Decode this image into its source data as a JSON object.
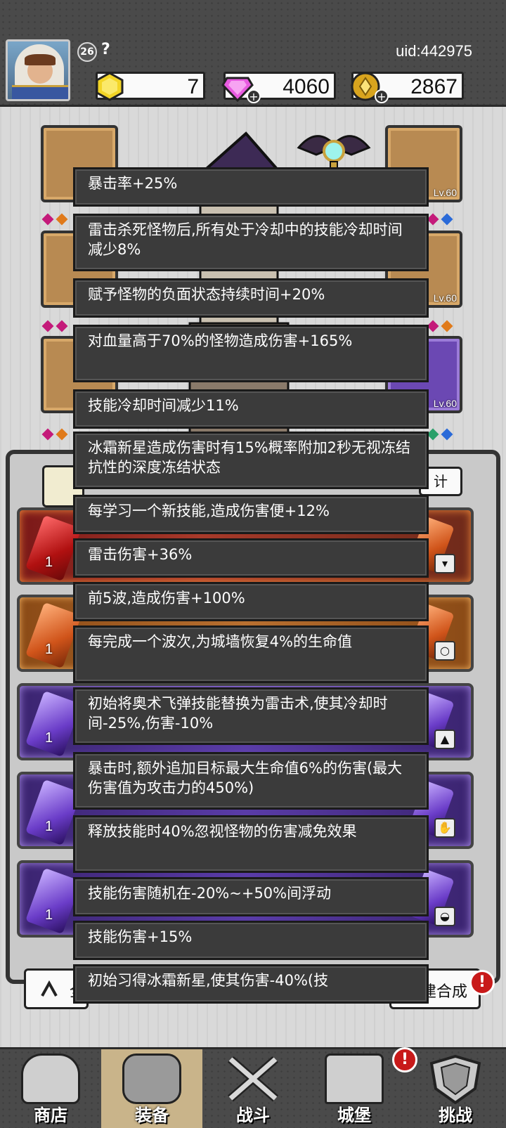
{
  "header": {
    "level": "26",
    "player_name": "?",
    "uid": "uid:442975",
    "resources": [
      {
        "name": "gold-gem",
        "value": "7",
        "color": "#f1d22a"
      },
      {
        "name": "diamond",
        "value": "4060",
        "color": "#e85ae0"
      },
      {
        "name": "coin",
        "value": "2867",
        "color": "#d8a41e"
      }
    ]
  },
  "equipment": {
    "slot_levels": [
      "Lv.60",
      "Lv.60",
      "Lv.60"
    ]
  },
  "inventory": {
    "right_button": "计",
    "rows": [
      {
        "count": "1",
        "rarity": "red"
      },
      {
        "count": "1",
        "rarity": "orange"
      },
      {
        "count": "1",
        "rarity": "purple"
      },
      {
        "count": "1",
        "rarity": "purple"
      },
      {
        "count": "1",
        "rarity": "purple"
      }
    ],
    "bottom_right_button": "建合成",
    "bottom_left_button": "全"
  },
  "tooltips": [
    "暴击率+25%",
    "雷击杀死怪物后,所有处于冷却中的技能冷却时间减少8%",
    "赋予怪物的负面状态持续时间+20%",
    "对血量高于70%的怪物造成伤害+165%",
    "技能冷却时间减少11%",
    "冰霜新星造成伤害时有15%概率附加2秒无视冻结抗性的深度冻结状态",
    "每学习一个新技能,造成伤害便+12%",
    "雷击伤害+36%",
    "前5波,造成伤害+100%",
    "每完成一个波次,为城墙恢复4%的生命值",
    "初始将奥术飞弹技能替换为雷击术,使其冷却时间-25%,伤害-10%",
    "暴击时,额外追加目标最大生命值6%的伤害(最大伤害值为攻击力的450%)",
    "释放技能时40%忽视怪物的伤害减免效果",
    "技能伤害随机在-20%~+50%间浮动",
    "技能伤害+15%",
    "初始习得冰霜新星,使其伤害-40%(技"
  ],
  "nav": {
    "items": [
      {
        "label": "商店",
        "icon": "shop-icon"
      },
      {
        "label": "装备",
        "icon": "backpack-icon",
        "active": true
      },
      {
        "label": "战斗",
        "icon": "crossed-swords-icon"
      },
      {
        "label": "城堡",
        "icon": "castle-icon",
        "alert": "!"
      },
      {
        "label": "挑战",
        "icon": "shield-icon"
      }
    ]
  },
  "alerts": {
    "inventory_alert": "!",
    "castle_alert": "!"
  }
}
